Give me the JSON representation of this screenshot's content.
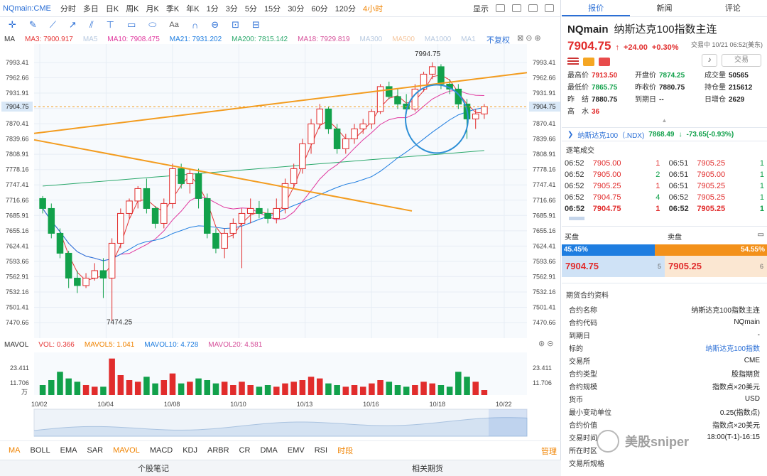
{
  "toolbar": {
    "symbol": "NQmain:CME",
    "timeframes": [
      "分时",
      "多日",
      "日K",
      "周K",
      "月K",
      "季K",
      "年K",
      "1分",
      "3分",
      "5分",
      "15分",
      "30分",
      "60分",
      "120分",
      "4小时"
    ],
    "active_timeframe": "4小时",
    "display_label": "显示"
  },
  "draw_toolbar": {
    "aa_label": "Aa"
  },
  "main_indicators": {
    "ma_label": "MA",
    "ma3": "MA3: 7900.917",
    "ma5": "MA5",
    "ma10": "MA10: 7908.475",
    "ma21": "MA21: 7931.202",
    "ma200": "MA200: 7815.142",
    "ma18": "MA18: 7929.819",
    "ma300": "MA300",
    "ma500": "MA500",
    "ma1000": "MA1000",
    "ma1": "MA1",
    "fuquan": "不复权"
  },
  "vol_indicators": {
    "label": "MAVOL",
    "vol": "VOL: 0.366",
    "mavol5": "MAVOL5: 1.041",
    "mavol10": "MAVOL10: 4.728",
    "mavol20": "MAVOL20: 4.581"
  },
  "colors": {
    "up": "#e12c2c",
    "down": "#12a14b",
    "ma3": "#e63737",
    "ma10": "#e0379e",
    "ma21": "#1e7de0",
    "ma200": "#2aa86b",
    "ma18": "#d6509a",
    "trendline": "#f39c1f",
    "accent": "#2b6fd6",
    "active": "#f08300"
  },
  "chart_data": {
    "type": "candlestick",
    "price_axis": [
      "7993.41",
      "7962.66",
      "7931.91",
      "7901.16",
      "7870.41",
      "7839.66",
      "7808.91",
      "7778.16",
      "7747.41",
      "7716.66",
      "7685.91",
      "7655.16",
      "7624.41",
      "7593.66",
      "7562.91",
      "7532.16",
      "7501.41",
      "7470.66"
    ],
    "current_price": "7904.75",
    "high_annotation": "7994.75",
    "low_annotation": "7474.25",
    "dates": [
      "10/02",
      "10/04",
      "10/08",
      "10/10",
      "10/13",
      "10/16",
      "10/18",
      "10/22"
    ],
    "vol_axis": [
      "23.411",
      "11.706",
      "万"
    ],
    "candles": [
      [
        7720,
        7725,
        7690,
        7700
      ],
      [
        7700,
        7710,
        7640,
        7650
      ],
      [
        7650,
        7660,
        7600,
        7610
      ],
      [
        7610,
        7615,
        7540,
        7560
      ],
      [
        7560,
        7575,
        7530,
        7545
      ],
      [
        7545,
        7570,
        7540,
        7560
      ],
      [
        7560,
        7590,
        7555,
        7575
      ],
      [
        7575,
        7600,
        7520,
        7560
      ],
      [
        7560,
        7640,
        7474,
        7630
      ],
      [
        7630,
        7700,
        7620,
        7690
      ],
      [
        7690,
        7720,
        7680,
        7715
      ],
      [
        7715,
        7745,
        7700,
        7740
      ],
      [
        7740,
        7760,
        7690,
        7700
      ],
      [
        7700,
        7705,
        7660,
        7670
      ],
      [
        7670,
        7720,
        7660,
        7710
      ],
      [
        7710,
        7790,
        7700,
        7780
      ],
      [
        7780,
        7790,
        7740,
        7750
      ],
      [
        7750,
        7780,
        7730,
        7770
      ],
      [
        7770,
        7780,
        7700,
        7720
      ],
      [
        7720,
        7730,
        7640,
        7650
      ],
      [
        7650,
        7660,
        7610,
        7620
      ],
      [
        7620,
        7660,
        7600,
        7650
      ],
      [
        7650,
        7680,
        7640,
        7670
      ],
      [
        7670,
        7700,
        7580,
        7690
      ],
      [
        7690,
        7720,
        7670,
        7700
      ],
      [
        7700,
        7715,
        7680,
        7690
      ],
      [
        7690,
        7700,
        7670,
        7680
      ],
      [
        7680,
        7720,
        7670,
        7700
      ],
      [
        7700,
        7760,
        7690,
        7750
      ],
      [
        7750,
        7790,
        7740,
        7780
      ],
      [
        7780,
        7840,
        7770,
        7830
      ],
      [
        7830,
        7880,
        7810,
        7870
      ],
      [
        7870,
        7910,
        7860,
        7900
      ],
      [
        7900,
        7905,
        7850,
        7860
      ],
      [
        7860,
        7870,
        7810,
        7820
      ],
      [
        7820,
        7850,
        7810,
        7840
      ],
      [
        7840,
        7870,
        7830,
        7860
      ],
      [
        7860,
        7880,
        7850,
        7870
      ],
      [
        7870,
        7900,
        7860,
        7895
      ],
      [
        7895,
        7950,
        7890,
        7945
      ],
      [
        7945,
        7955,
        7920,
        7925
      ],
      [
        7925,
        7940,
        7900,
        7910
      ],
      [
        7910,
        7930,
        7890,
        7900
      ],
      [
        7900,
        7950,
        7895,
        7940
      ],
      [
        7940,
        7975,
        7935,
        7970
      ],
      [
        7970,
        7994,
        7960,
        7985
      ],
      [
        7985,
        7990,
        7940,
        7950
      ],
      [
        7950,
        7960,
        7930,
        7940
      ],
      [
        7940,
        7950,
        7900,
        7910
      ],
      [
        7910,
        7920,
        7840,
        7880
      ],
      [
        7880,
        7900,
        7860,
        7890
      ],
      [
        7890,
        7910,
        7880,
        7905
      ]
    ],
    "volumes": [
      6,
      9,
      14,
      10,
      8,
      6,
      5,
      5,
      22,
      12,
      9,
      8,
      11,
      7,
      9,
      13,
      7,
      8,
      10,
      9,
      7,
      8,
      6,
      8,
      6,
      5,
      6,
      5,
      7,
      8,
      9,
      11,
      10,
      7,
      6,
      5,
      6,
      5,
      7,
      9,
      8,
      6,
      5,
      6,
      8,
      7,
      6,
      5,
      14,
      11,
      8,
      3
    ]
  },
  "bottom_tabs": [
    "MA",
    "BOLL",
    "EMA",
    "SAR",
    "MAVOL",
    "MACD",
    "KDJ",
    "ARBR",
    "CR",
    "DMA",
    "EMV",
    "RSI",
    "时段"
  ],
  "bottom_active": [
    "MA",
    "MAVOL",
    "时段"
  ],
  "manage_label": "管理",
  "footer": {
    "left": "个股笔记",
    "right": "相关期货"
  },
  "right_tabs": [
    "报价",
    "新闻",
    "评论"
  ],
  "quote": {
    "code": "NQmain",
    "name": "纳斯达克100指数主连",
    "price": "7904.75",
    "arrow": "↑",
    "change": "+24.00",
    "pct": "+0.30%",
    "time": "交易中 10/21 06:52(美东)",
    "trade_btn": "交易",
    "stats": [
      [
        "最高价",
        "7913.50",
        "r"
      ],
      [
        "开盘价",
        "7874.25",
        "g"
      ],
      [
        "成交量",
        "50565",
        "b"
      ],
      [
        "最低价",
        "7865.75",
        "g"
      ],
      [
        "昨收价",
        "7880.75",
        "b"
      ],
      [
        "持仓量",
        "215612",
        "b"
      ],
      [
        "昨　结",
        "7880.75",
        "b"
      ],
      [
        "到期日",
        "--",
        "b"
      ],
      [
        "日增仓",
        "2629",
        "b"
      ],
      [
        "高　水",
        "36",
        "r"
      ]
    ]
  },
  "index_line": {
    "name": "纳斯达克100（.NDX)",
    "value": "7868.49",
    "arrow": "↓",
    "change": "-73.65(-0.93%)"
  },
  "ticks_title": "逐笔成交",
  "ticks": [
    [
      "06:52",
      "7905.00",
      "1",
      "r",
      "06:51",
      "7905.25",
      "1",
      "g"
    ],
    [
      "06:52",
      "7905.00",
      "2",
      "g",
      "06:51",
      "7905.00",
      "1",
      "g"
    ],
    [
      "06:52",
      "7905.25",
      "1",
      "r",
      "06:51",
      "7905.25",
      "1",
      "g"
    ],
    [
      "06:52",
      "7904.75",
      "4",
      "g",
      "06:52",
      "7905.25",
      "1",
      "g"
    ],
    [
      "06:52",
      "7904.75",
      "1",
      "r",
      "06:52",
      "7905.25",
      "1",
      "g"
    ]
  ],
  "orderbook": {
    "buy_label": "买盘",
    "sell_label": "卖盘",
    "buy_pct": "45.45%",
    "sell_pct": "54.55%",
    "buy_price": "7904.75",
    "buy_qty": "5",
    "sell_price": "7905.25",
    "sell_qty": "6"
  },
  "contract_title": "期货合约资料",
  "contract": [
    [
      "合约名称",
      "纳斯达克100指数主连",
      ""
    ],
    [
      "合约代码",
      "NQmain",
      ""
    ],
    [
      "到期日",
      "-",
      ""
    ],
    [
      "标的",
      "纳斯达克100指数",
      "link"
    ],
    [
      "交易所",
      "CME",
      ""
    ],
    [
      "合约类型",
      "股指期货",
      ""
    ],
    [
      "合约规模",
      "指数点×20美元",
      ""
    ],
    [
      "货币",
      "USD",
      ""
    ],
    [
      "最小变动单位",
      "0.25(指数点)",
      ""
    ],
    [
      "合约价值",
      "指数点×20美元",
      ""
    ],
    [
      "交易时间",
      "18:00(T-1)-16:15",
      ""
    ],
    [
      "所在时区",
      "",
      ""
    ],
    [
      "交易所规格",
      "",
      ""
    ]
  ],
  "watermark": "美股sniper"
}
